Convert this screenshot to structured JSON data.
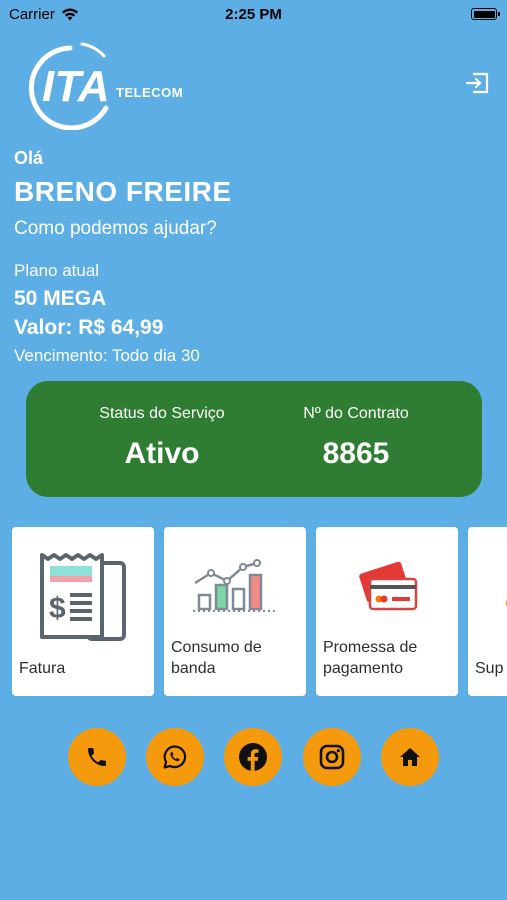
{
  "status_bar": {
    "carrier": "Carrier",
    "time": "2:25 PM"
  },
  "brand": {
    "logo_text": "ITA",
    "logo_sub": "TELECOM"
  },
  "greeting": "Olá",
  "user_name": "BRENO FREIRE",
  "help_text": "Como podemos ajudar?",
  "plan": {
    "label": "Plano atual",
    "name": "50 MEGA",
    "value": "Valor: R$ 64,99",
    "due": "Vencimento: Todo dia 30"
  },
  "status_card": {
    "status_label": "Status do Serviço",
    "status_value": "Ativo",
    "contract_label": "Nº do Contrato",
    "contract_value": "8865",
    "color": "#2e7d32"
  },
  "cards": [
    {
      "label": "Fatura",
      "icon": "invoice-icon"
    },
    {
      "label": "Consumo de banda",
      "icon": "bar-chart-icon"
    },
    {
      "label": "Promessa de pagamento",
      "icon": "credit-card-icon"
    },
    {
      "label": "Sup",
      "icon": "support-icon"
    }
  ],
  "social": [
    {
      "icon": "phone-icon"
    },
    {
      "icon": "whatsapp-icon"
    },
    {
      "icon": "facebook-icon"
    },
    {
      "icon": "instagram-icon"
    },
    {
      "icon": "home-icon"
    }
  ],
  "colors": {
    "background": "#5eaee6",
    "accent": "#f59a0c",
    "status_card": "#2e7d32"
  }
}
